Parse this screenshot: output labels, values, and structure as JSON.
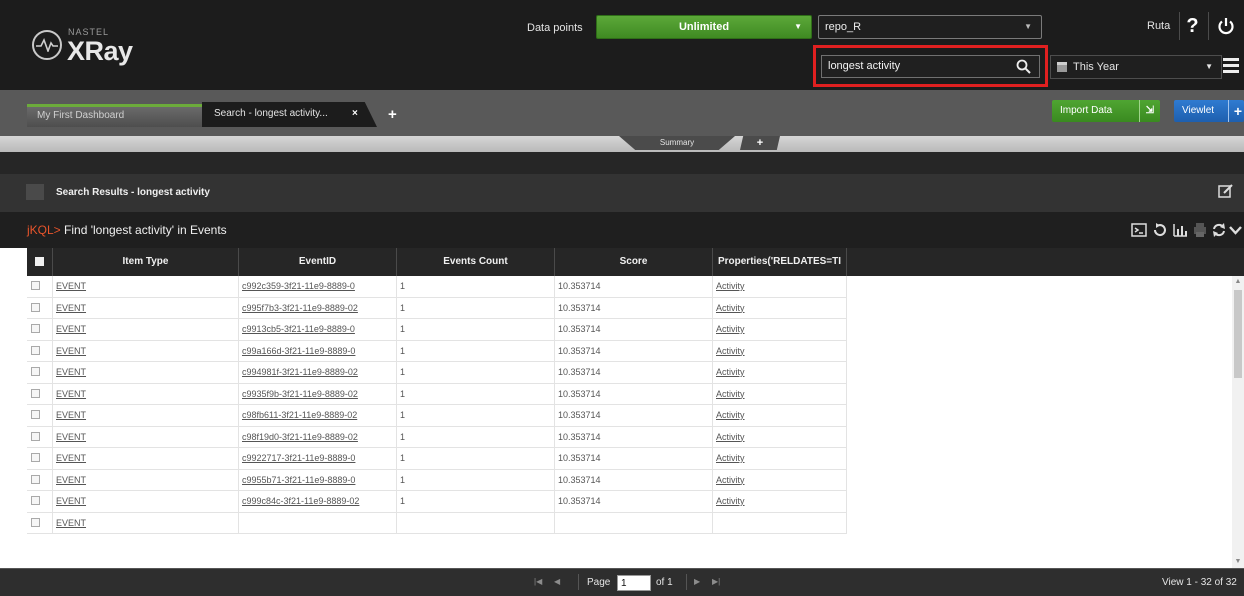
{
  "header": {
    "logo_small": "NASTEL",
    "logo_big": "XRay",
    "data_points_label": "Data points",
    "data_points_value": "Unlimited",
    "repository": "repo_R",
    "user_name": "Ruta",
    "help_label": "?",
    "search_value": "longest activity",
    "date_range": "This Year"
  },
  "tabs": {
    "items": [
      {
        "label": "My First Dashboard"
      },
      {
        "label": "Search - longest activity..."
      }
    ],
    "close_label": "×",
    "add_label": "+",
    "import_label": "Import Data",
    "viewlet_label": "Viewlet",
    "viewlet_plus": "+"
  },
  "summary": {
    "tab_label": "Summary",
    "add_label": "+"
  },
  "panel": {
    "title": "Search Results - longest activity",
    "query_prefix": "jKQL>",
    "query_text": " Find 'longest activity' in  Events"
  },
  "grid": {
    "columns": [
      "Item Type",
      "EventID",
      "Events Count",
      "Score",
      "Properties('RELDATES=TI"
    ],
    "rows": [
      {
        "type": "EVENT",
        "id": "c992c359-3f21-11e9-8889-0",
        "count": "1",
        "score": "10.353714",
        "prop": "Activity"
      },
      {
        "type": "EVENT",
        "id": "c995f7b3-3f21-11e9-8889-02",
        "count": "1",
        "score": "10.353714",
        "prop": "Activity"
      },
      {
        "type": "EVENT",
        "id": "c9913cb5-3f21-11e9-8889-0",
        "count": "1",
        "score": "10.353714",
        "prop": "Activity"
      },
      {
        "type": "EVENT",
        "id": "c99a166d-3f21-11e9-8889-0",
        "count": "1",
        "score": "10.353714",
        "prop": "Activity"
      },
      {
        "type": "EVENT",
        "id": "c994981f-3f21-11e9-8889-02",
        "count": "1",
        "score": "10.353714",
        "prop": "Activity"
      },
      {
        "type": "EVENT",
        "id": "c9935f9b-3f21-11e9-8889-02",
        "count": "1",
        "score": "10.353714",
        "prop": "Activity"
      },
      {
        "type": "EVENT",
        "id": "c98fb611-3f21-11e9-8889-02",
        "count": "1",
        "score": "10.353714",
        "prop": "Activity"
      },
      {
        "type": "EVENT",
        "id": "c98f19d0-3f21-11e9-8889-02",
        "count": "1",
        "score": "10.353714",
        "prop": "Activity"
      },
      {
        "type": "EVENT",
        "id": "c9922717-3f21-11e9-8889-0",
        "count": "1",
        "score": "10.353714",
        "prop": "Activity"
      },
      {
        "type": "EVENT",
        "id": "c9955b71-3f21-11e9-8889-0",
        "count": "1",
        "score": "10.353714",
        "prop": "Activity"
      },
      {
        "type": "EVENT",
        "id": "c999c84c-3f21-11e9-8889-02",
        "count": "1",
        "score": "10.353714",
        "prop": "Activity"
      },
      {
        "type": "EVENT",
        "id": "",
        "count": "",
        "score": "",
        "prop": ""
      }
    ]
  },
  "pager": {
    "page_label": "Page",
    "page_value": "1",
    "of_label": "of 1",
    "view_label": "View 1 - 32 of 32"
  },
  "colors": {
    "accent_green": "#4fa532",
    "accent_blue": "#2f7bd1",
    "highlight_red": "#e02020",
    "jkql_orange": "#e8542b"
  },
  "icons": [
    "power-icon",
    "search-icon",
    "calendar-icon",
    "menu-icon",
    "edit-icon",
    "terminal-icon",
    "refresh-icon",
    "chart-icon",
    "print-icon",
    "sync-icon",
    "chevron-down-icon"
  ]
}
